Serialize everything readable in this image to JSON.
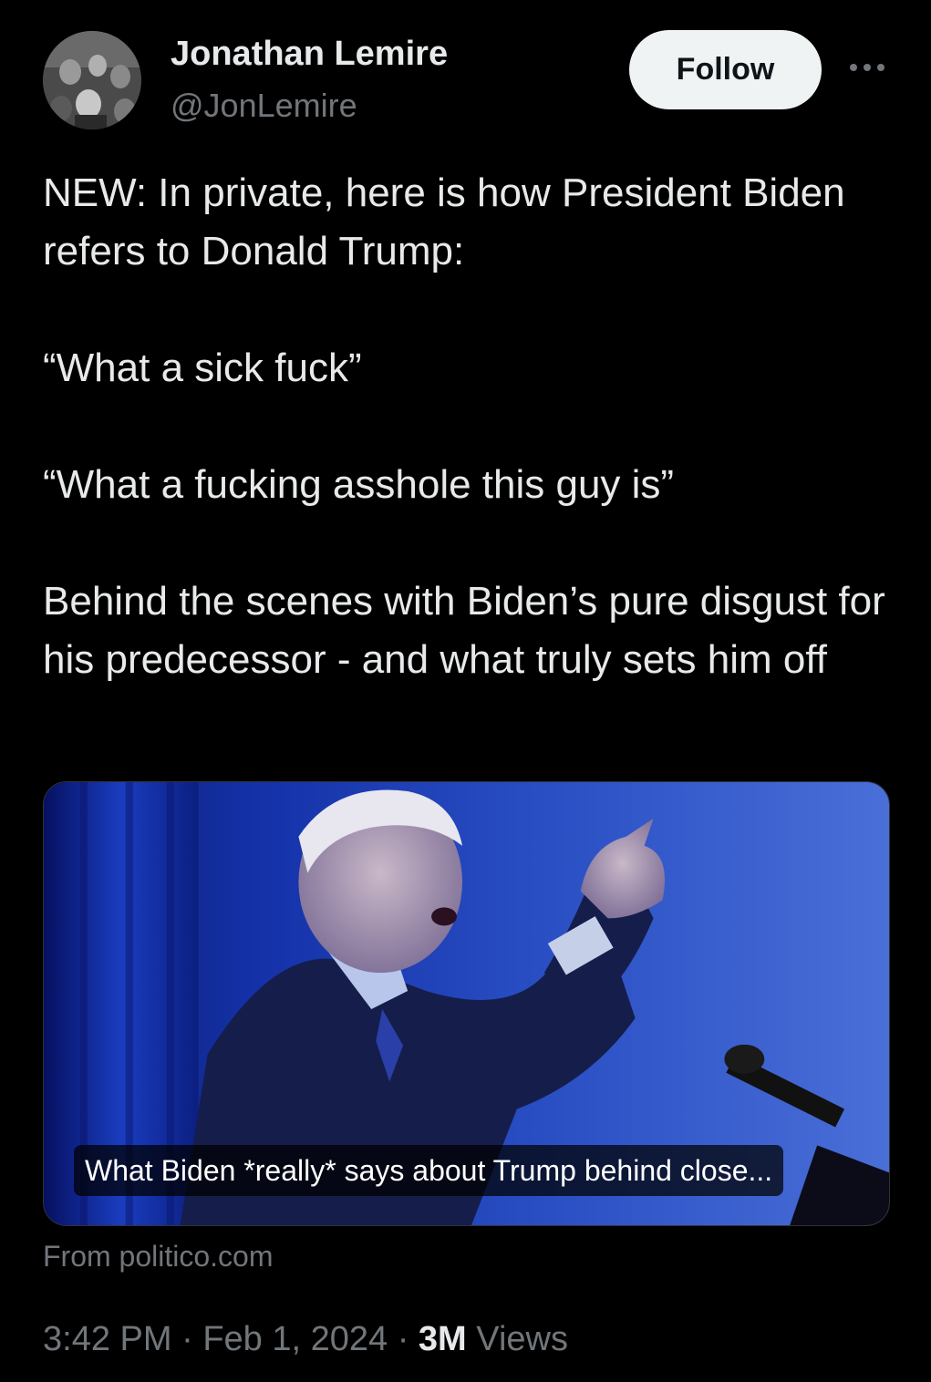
{
  "author": {
    "name": "Jonathan Lemire",
    "handle": "@JonLemire",
    "follow_label": "Follow"
  },
  "tweet": {
    "paragraphs": [
      "NEW: In private, here is how President Biden refers to Donald Trump:",
      "“What a sick fuck”",
      "“What a fucking asshole this guy is”",
      "Behind the scenes with Biden’s pure disgust for his predecessor - and what truly sets him off"
    ]
  },
  "card": {
    "title": "What Biden *really* says about Trump behind close...",
    "source": "From politico.com"
  },
  "meta": {
    "time": "3:42 PM",
    "separator": "·",
    "date": "Feb 1, 2024",
    "views_count": "3M",
    "views_label": "Views"
  },
  "icons": {
    "more": "more-horizontal-icon"
  },
  "colors": {
    "background": "#000000",
    "text_primary": "#e7e9ea",
    "text_secondary": "#71767b",
    "follow_bg": "#eff3f4",
    "follow_text": "#0f1419"
  }
}
